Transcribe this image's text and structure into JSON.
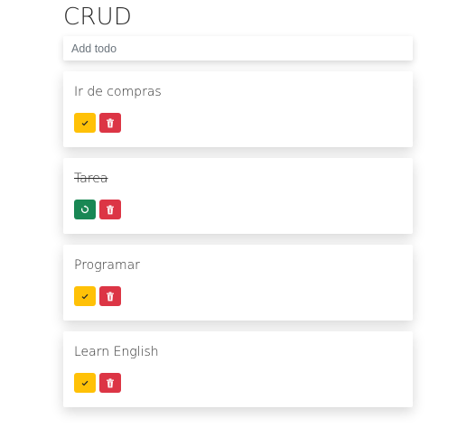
{
  "header": {
    "title": "CRUD"
  },
  "add_input": {
    "placeholder": "Add todo",
    "value": ""
  },
  "todos": [
    {
      "text": "Ir de compras",
      "completed": false
    },
    {
      "text": "Tarea",
      "completed": true
    },
    {
      "text": "Programar",
      "completed": false
    },
    {
      "text": "Learn English",
      "completed": false
    }
  ],
  "icons": {
    "complete": "check-icon",
    "undo": "undo-icon",
    "delete": "trash-icon"
  },
  "colors": {
    "complete": "#ffc107",
    "undo": "#198754",
    "delete": "#dc3545"
  }
}
